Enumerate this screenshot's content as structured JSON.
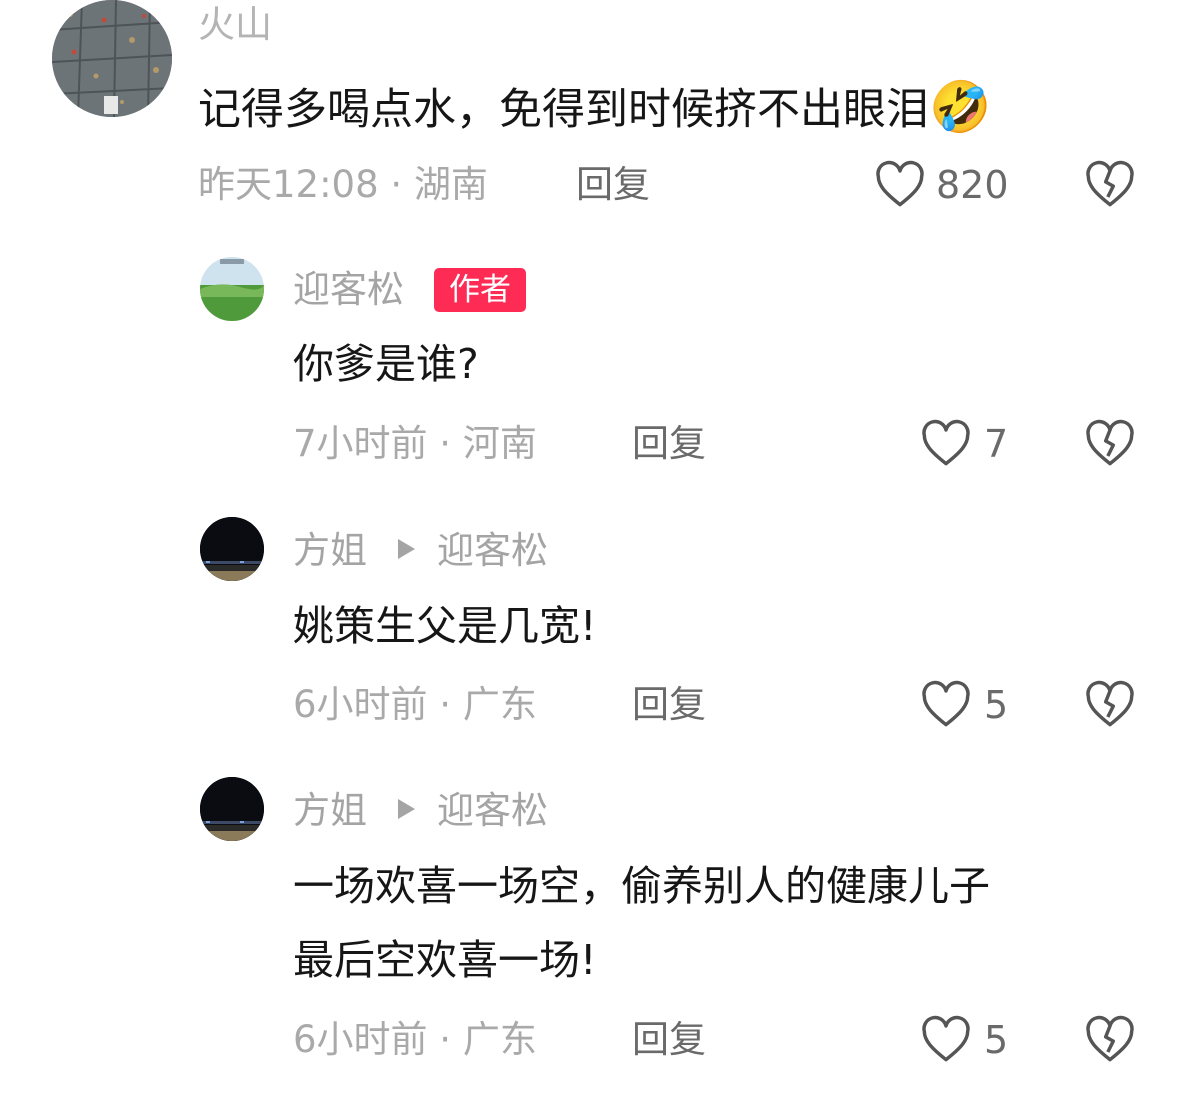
{
  "comments": [
    {
      "username": "火山",
      "text": "记得多喝点水，免得到时候挤不出眼泪",
      "emoji": "🤣",
      "time": "昨天12:08",
      "location": "湖南",
      "reply_label": "回复",
      "likes": "820"
    },
    {
      "username": "迎客松",
      "badge": "作者",
      "text": "你爹是谁?",
      "time": "7小时前",
      "location": "河南",
      "reply_label": "回复",
      "likes": "7"
    },
    {
      "username": "方姐",
      "reply_to": "迎客松",
      "text": "姚策生父是几宽!",
      "time": "6小时前",
      "location": "广东",
      "reply_label": "回复",
      "likes": "5"
    },
    {
      "username": "方姐",
      "reply_to": "迎客松",
      "text_line1": "一场欢喜一场空，偷养别人的健康儿子",
      "text_line2": "最后空欢喜一场!",
      "time": "6小时前",
      "location": "广东",
      "reply_label": "回复",
      "likes": "5"
    }
  ],
  "separator": " · ",
  "icons": {
    "like": "heart-outline-icon",
    "dislike": "broken-heart-icon",
    "reply_arrow": "triangle-right-icon"
  },
  "colors": {
    "author_badge": "#fe2c55",
    "meta_text": "#a9a9a9",
    "body_text": "#161616"
  }
}
